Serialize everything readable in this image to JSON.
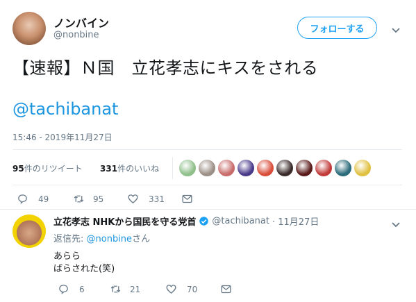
{
  "tweet": {
    "author": {
      "display_name": "ノンバイン",
      "handle": "@nonbine"
    },
    "follow_label": "フォローする",
    "text": "【速報】Ｎ国　立花孝志にキスをされる",
    "mention": "@tachibanat",
    "timestamp": "15:46 - 2019年11月27日",
    "stats": {
      "retweet_count": "95",
      "retweet_label": "件のリツイート",
      "like_count": "331",
      "like_label": "件のいいね"
    },
    "likers": [
      "#8fbf8a",
      "#9c8f86",
      "#c96a6a",
      "#4a3a8a",
      "#d94d3a",
      "#3a2a2a",
      "#5a1a1a",
      "#c23a3a",
      "#2b6b7a",
      "#e0c040"
    ],
    "actions": {
      "reply": "49",
      "retweet": "95",
      "like": "331"
    }
  },
  "reply": {
    "author": {
      "display_name": "立花孝志 NHKから国民を守る党首",
      "handle": "@tachibanat",
      "date": "· 11月27日"
    },
    "replying_to_prefix": "返信先: ",
    "replying_to_handle": "@nonbine",
    "replying_to_suffix": "さん",
    "lines": [
      "あらら",
      "ばらされた(笑)"
    ],
    "actions": {
      "reply": "6",
      "retweet": "21",
      "like": "70"
    }
  },
  "colors": {
    "accent": "#1da1f2",
    "link": "#1b95e0",
    "muted": "#657786",
    "verified": "#1da1f2"
  }
}
